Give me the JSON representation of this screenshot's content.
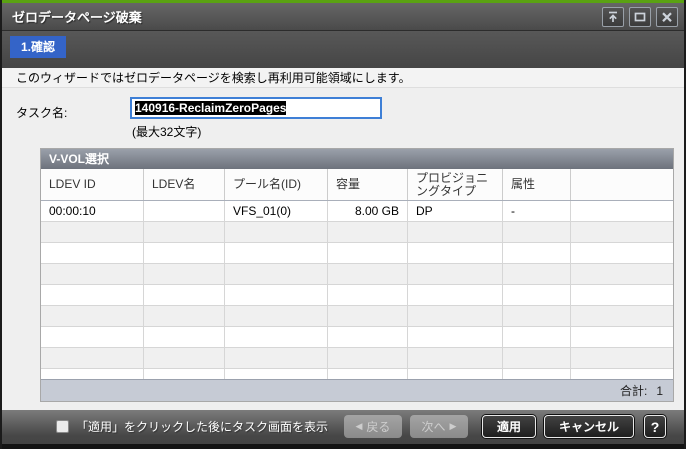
{
  "window": {
    "title": "ゼロデータページ破棄"
  },
  "wizard": {
    "step_tab": "1.確認"
  },
  "description": "このウィザードではゼロデータページを検索し再利用可能領域にします。",
  "task": {
    "label": "タスク名:",
    "value": "140916-ReclaimZeroPages",
    "max_hint": "(最大32文字)"
  },
  "vvol_table": {
    "title": "V-VOL選択",
    "columns": [
      "LDEV ID",
      "LDEV名",
      "プール名(ID)",
      "容量",
      "プロビジョニングタイプ",
      "属性",
      ""
    ],
    "rows": [
      {
        "ldev_id": "00:00:10",
        "ldev_name": "",
        "pool": "VFS_01(0)",
        "capacity": "8.00 GB",
        "prov_type": "DP",
        "attribute": "-",
        "extra": ""
      }
    ],
    "empty_rows": 9,
    "total_label": "合計:",
    "total_value": "1"
  },
  "footer": {
    "checkbox_label": "「適用」をクリックした後にタスク画面を表示",
    "checkbox_checked": false,
    "back_arrow": "◀",
    "back_button": "戻る",
    "next_button": "次へ",
    "next_arrow": "▶",
    "apply_button": "適用",
    "cancel_button": "キャンセル",
    "help_button": "?"
  },
  "colors": {
    "accent_green": "#5aa212",
    "tab_blue": "#3464c8",
    "input_focus_blue": "#3e7fd6",
    "table_footer_gray": "#c6cbd5"
  }
}
